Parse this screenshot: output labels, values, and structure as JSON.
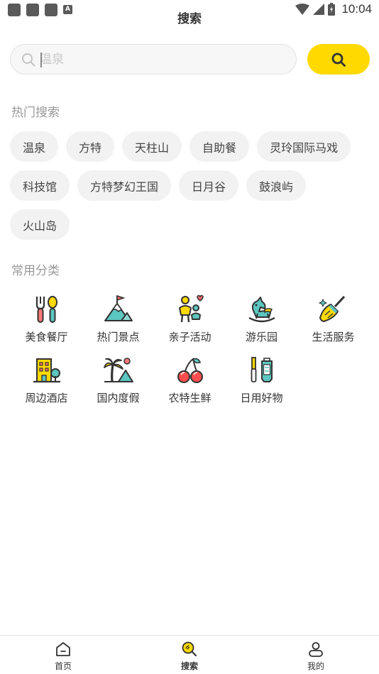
{
  "status_bar": {
    "time": "10:04",
    "notification_badge": "A"
  },
  "header": {
    "title": "搜索"
  },
  "search": {
    "placeholder": "温泉",
    "value": ""
  },
  "hot_search": {
    "title": "热门搜索",
    "tags": [
      "温泉",
      "方特",
      "天柱山",
      "自助餐",
      "灵玲国际马戏",
      "科技馆",
      "方特梦幻王国",
      "日月谷",
      "鼓浪屿",
      "火山岛"
    ]
  },
  "categories": {
    "title": "常用分类",
    "items": [
      {
        "label": "美食餐厅",
        "icon": "cutlery-icon"
      },
      {
        "label": "热门景点",
        "icon": "mountain-flag-icon"
      },
      {
        "label": "亲子活动",
        "icon": "parent-child-icon"
      },
      {
        "label": "游乐园",
        "icon": "rocking-horse-icon"
      },
      {
        "label": "生活服务",
        "icon": "broom-icon"
      },
      {
        "label": "周边酒店",
        "icon": "hotel-building-icon"
      },
      {
        "label": "国内度假",
        "icon": "palm-tree-icon"
      },
      {
        "label": "农特生鲜",
        "icon": "cherry-icon"
      },
      {
        "label": "日用好物",
        "icon": "toothbrush-toothpaste-icon"
      }
    ]
  },
  "tabbar": {
    "tabs": [
      {
        "label": "首页",
        "icon": "home-icon"
      },
      {
        "label": "搜索",
        "icon": "search-icon",
        "active": true
      },
      {
        "label": "我的",
        "icon": "user-icon"
      }
    ]
  },
  "colors": {
    "accent": "#ffd900",
    "tag_bg": "#f2f2f2",
    "section_title": "#999999"
  }
}
